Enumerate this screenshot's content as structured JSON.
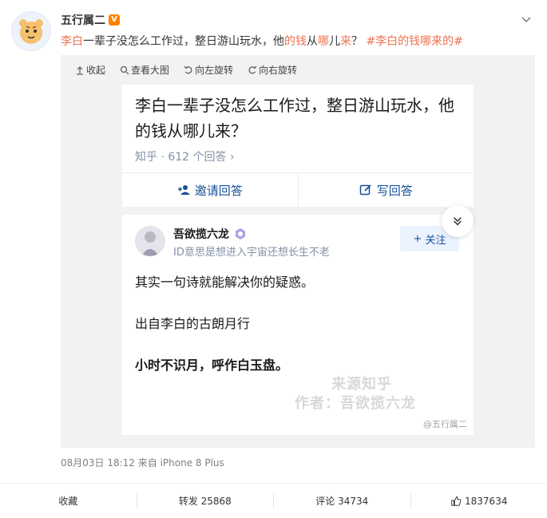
{
  "post": {
    "username": "五行属二",
    "verified_badge": "V",
    "text_part1": "李白",
    "text_part2": "一辈子没怎么工作过，整日游山玩水，他",
    "text_part3": "的钱",
    "text_part4": "从",
    "text_part5": "哪",
    "text_part6": "儿",
    "text_part7": "来",
    "text_part8": "？ ",
    "hashtag": "#李白的钱哪来的#",
    "timestamp": "08月03日 18:12  来自 iPhone 8 Plus"
  },
  "toolbar": {
    "collapse": "收起",
    "view_large": "查看大图",
    "rotate_left": "向左旋转",
    "rotate_right": "向右旋转"
  },
  "zhihu": {
    "question": "李白一辈子没怎么工作过，整日游山玩水，他的钱从哪儿来？",
    "meta": "知乎 · 612 个回答 ›",
    "invite_label": "邀请回答",
    "write_label": "写回答",
    "answerer_name": "吾欲揽六龙",
    "answerer_bio": "ID意思是想进入宇宙还想长生不老",
    "follow_label": "关注",
    "answer_line1": "其实一句诗就能解决你的疑惑。",
    "answer_line2": "出自李白的古朗月行",
    "answer_line3": "小时不识月，呼作白玉盘。",
    "watermark_line1": "来源知乎",
    "watermark_line2": "作者：吾欲揽六龙",
    "weibo_watermark": "@五行属二"
  },
  "footer": {
    "favorite": "收藏",
    "repost": "转发 25868",
    "comment": "评论 34734",
    "like": "1837634"
  },
  "colors": {
    "accent_orange": "#eb7350",
    "zhihu_blue": "#175199",
    "media_bg": "#f2f2f5"
  }
}
